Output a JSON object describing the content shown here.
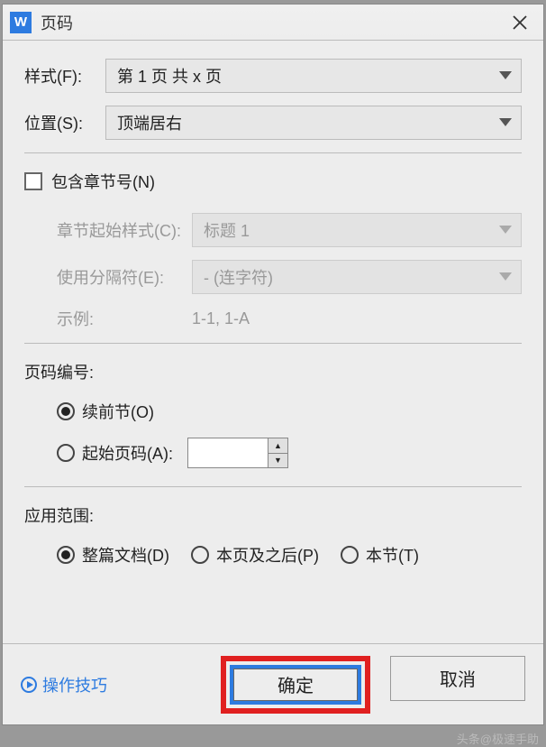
{
  "titlebar": {
    "icon_letter": "W",
    "title": "页码"
  },
  "form": {
    "style_label": "样式(F):",
    "style_value": "第 1 页 共 x 页",
    "position_label": "位置(S):",
    "position_value": "顶端居右"
  },
  "chapter": {
    "include_label": "包含章节号(N)",
    "start_style_label": "章节起始样式(C):",
    "start_style_value": "标题 1",
    "separator_label": "使用分隔符(E):",
    "separator_value": "-     (连字符)",
    "example_label": "示例:",
    "example_value": "1-1, 1-A"
  },
  "numbering": {
    "section_title": "页码编号:",
    "continue_label": "续前节(O)",
    "start_at_label": "起始页码(A):"
  },
  "scope": {
    "section_title": "应用范围:",
    "whole_doc": "整篇文档(D)",
    "this_and_after": "本页及之后(P)",
    "this_section": "本节(T)"
  },
  "footer": {
    "tips_label": "操作技巧",
    "ok_label": "确定",
    "cancel_label": "取消"
  },
  "watermark": "头条@极速手助"
}
